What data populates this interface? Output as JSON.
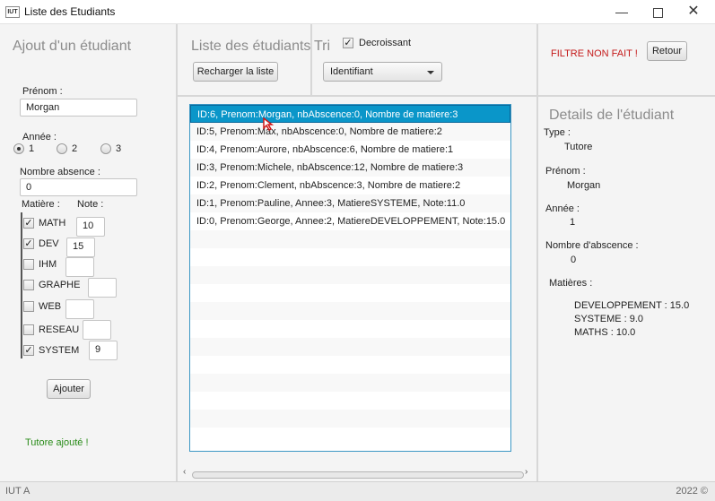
{
  "window": {
    "title": "Liste des Etudiants",
    "app_icon_text": "IUT"
  },
  "add_panel": {
    "title": "Ajout d'un étudiant",
    "prenom_label": "Prénom :",
    "prenom_value": "Morgan",
    "annee_label": "Année :",
    "annee_options": [
      "1",
      "2",
      "3"
    ],
    "annee_selected": "1",
    "absence_label": "Nombre absence :",
    "absence_value": "0",
    "matiere_label": "Matière :",
    "note_label": "Note :",
    "matieres": [
      {
        "name": "MATH",
        "checked": true,
        "note": "10"
      },
      {
        "name": "DEV",
        "checked": true,
        "note": "15"
      },
      {
        "name": "IHM",
        "checked": false,
        "note": ""
      },
      {
        "name": "GRAPHE",
        "checked": false,
        "note": ""
      },
      {
        "name": "WEB",
        "checked": false,
        "note": ""
      },
      {
        "name": "RESEAU",
        "checked": false,
        "note": ""
      },
      {
        "name": "SYSTEM",
        "checked": true,
        "note": "9"
      }
    ],
    "add_button": "Ajouter",
    "status": "Tutore ajouté !",
    "status_color": "#2a8c1a"
  },
  "list_panel": {
    "title": "Liste des étudiants",
    "tri_label": "Tri",
    "reload_button": "Recharger la liste",
    "decroissant_label": "Decroissant",
    "decroissant_checked": true,
    "sort_value": "Identifiant",
    "items": [
      "ID:6, Prenom:Morgan, nbAbscence:0, Nombre de matiere:3",
      "ID:5, Prenom:Max, nbAbscence:0, Nombre de matiere:2",
      "ID:4, Prenom:Aurore, nbAbscence:6, Nombre de matiere:1",
      "ID:3, Prenom:Michele, nbAbscence:12, Nombre de matiere:3",
      "ID:2, Prenom:Clement, nbAbscence:3, Nombre de matiere:2",
      "ID:1, Prenom:Pauline, Annee:3, MatiereSYSTEME, Note:11.0",
      "ID:0, Prenom:George, Annee:2, MatiereDEVELOPPEMENT, Note:15.0"
    ],
    "selected_index": 0
  },
  "details_panel": {
    "filter_text": "FILTRE NON FAIT !",
    "filter_color": "#c41a1a",
    "back_button": "Retour",
    "title": "Details de l'étudiant",
    "type_label": "Type :",
    "type_value": "Tutore",
    "prenom_label": "Prénom :",
    "prenom_value": "Morgan",
    "annee_label": "Année :",
    "annee_value": "1",
    "absence_label": "Nombre d'abscence :",
    "absence_value": "0",
    "matieres_label": "Matières :",
    "matieres": [
      "DEVELOPPEMENT : 15.0",
      "SYSTEME : 9.0",
      "MATHS : 10.0"
    ]
  },
  "statusbar": {
    "left": "IUT A",
    "right": "2022 ©"
  }
}
